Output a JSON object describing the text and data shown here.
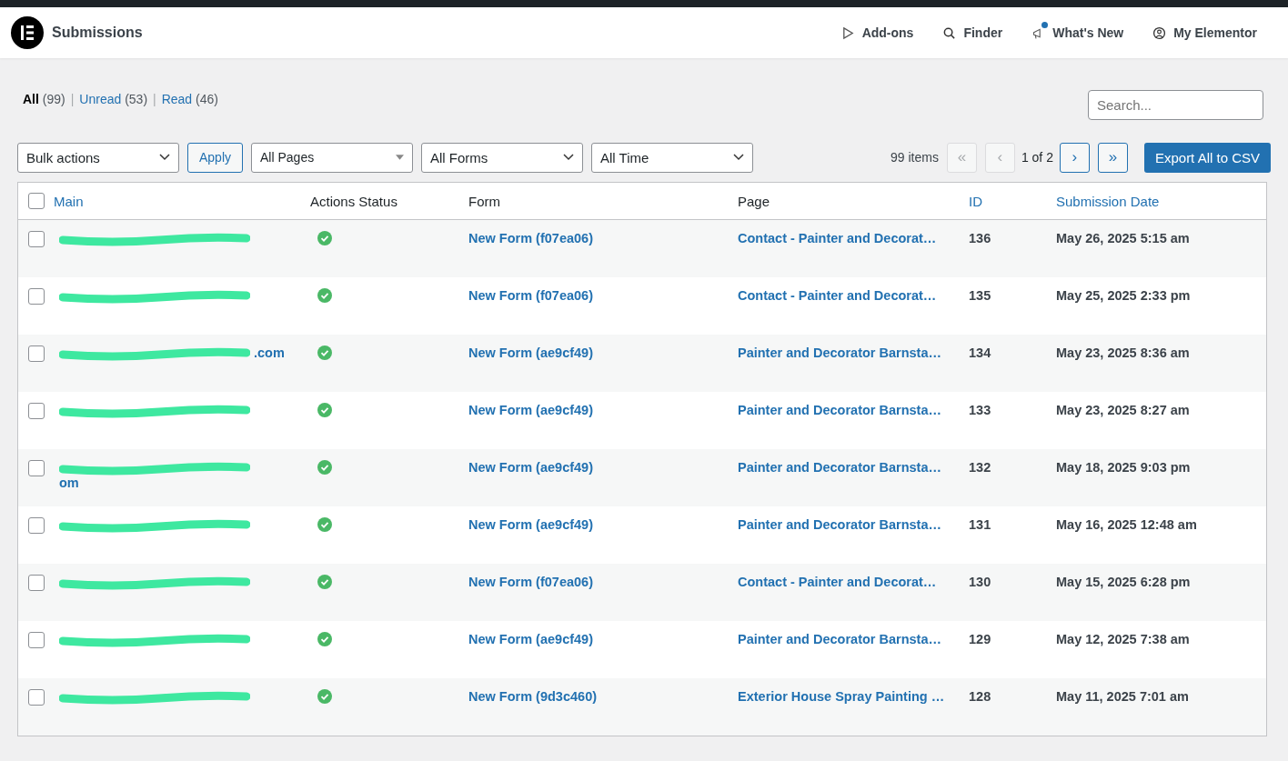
{
  "header": {
    "title": "Submissions",
    "nav": [
      {
        "kind": "addons",
        "label": "Add-ons",
        "dot": false
      },
      {
        "kind": "finder",
        "label": "Finder",
        "dot": false
      },
      {
        "kind": "news",
        "label": "What's New",
        "dot": true
      },
      {
        "kind": "account",
        "label": "My Elementor",
        "dot": false
      }
    ]
  },
  "filter_separator": "|",
  "filters": [
    {
      "label": "All",
      "count": "(99)",
      "selected": true
    },
    {
      "label": "Unread",
      "count": "(53)",
      "selected": false
    },
    {
      "label": "Read",
      "count": "(46)",
      "selected": false
    }
  ],
  "search": {
    "placeholder": "Search..."
  },
  "toolbar": {
    "bulk": "Bulk actions",
    "apply": "Apply",
    "pages": "All Pages",
    "forms": "All Forms",
    "time": "All Time",
    "items": "99 items",
    "first": "«",
    "prev": "‹",
    "page": "1 of 2",
    "next": "›",
    "last": "»",
    "export": "Export All to CSV"
  },
  "table": {
    "select_all": {
      "checked": false
    },
    "columns": [
      {
        "label": "Main",
        "sortable": true
      },
      {
        "label": "Actions Status",
        "sortable": false
      },
      {
        "label": "Form",
        "sortable": false
      },
      {
        "label": "Page",
        "sortable": false
      },
      {
        "label": "ID",
        "sortable": true
      },
      {
        "label": "Submission Date",
        "sortable": true
      }
    ],
    "rows": [
      {
        "checked": false,
        "redacted": true,
        "ok": true,
        "form": "New Form (f07ea06)",
        "page": "Contact - Painter and Decorat…",
        "id": "136",
        "date": "May 26, 2025 5:15 am"
      },
      {
        "checked": false,
        "redacted": true,
        "ok": true,
        "form": "New Form (f07ea06)",
        "page": "Contact - Painter and Decorat…",
        "id": "135",
        "date": "May 25, 2025 2:33 pm"
      },
      {
        "checked": false,
        "redacted": true,
        "tail": ".com",
        "ok": true,
        "form": "New Form (ae9cf49)",
        "page": "Painter and Decorator Barnsta…",
        "id": "134",
        "date": "May 23, 2025 8:36 am"
      },
      {
        "checked": false,
        "redacted": true,
        "ok": true,
        "form": "New Form (ae9cf49)",
        "page": "Painter and Decorator Barnsta…",
        "id": "133",
        "date": "May 23, 2025 8:27 am"
      },
      {
        "checked": false,
        "redacted": true,
        "second_line": "om",
        "ok": true,
        "form": "New Form (ae9cf49)",
        "page": "Painter and Decorator Barnsta…",
        "id": "132",
        "date": "May 18, 2025 9:03 pm"
      },
      {
        "checked": false,
        "redacted": true,
        "ok": true,
        "form": "New Form (ae9cf49)",
        "page": "Painter and Decorator Barnsta…",
        "id": "131",
        "date": "May 16, 2025 12:48 am"
      },
      {
        "checked": false,
        "redacted": true,
        "ok": true,
        "form": "New Form (f07ea06)",
        "page": "Contact - Painter and Decorat…",
        "id": "130",
        "date": "May 15, 2025 6:28 pm"
      },
      {
        "checked": false,
        "redacted": true,
        "ok": true,
        "form": "New Form (ae9cf49)",
        "page": "Painter and Decorator Barnsta…",
        "id": "129",
        "date": "May 12, 2025 7:38 am"
      },
      {
        "checked": false,
        "redacted": true,
        "ok": true,
        "form": "New Form (9d3c460)",
        "page": "Exterior House Spray Painting …",
        "id": "128",
        "date": "May 11, 2025 7:01 am"
      }
    ]
  }
}
